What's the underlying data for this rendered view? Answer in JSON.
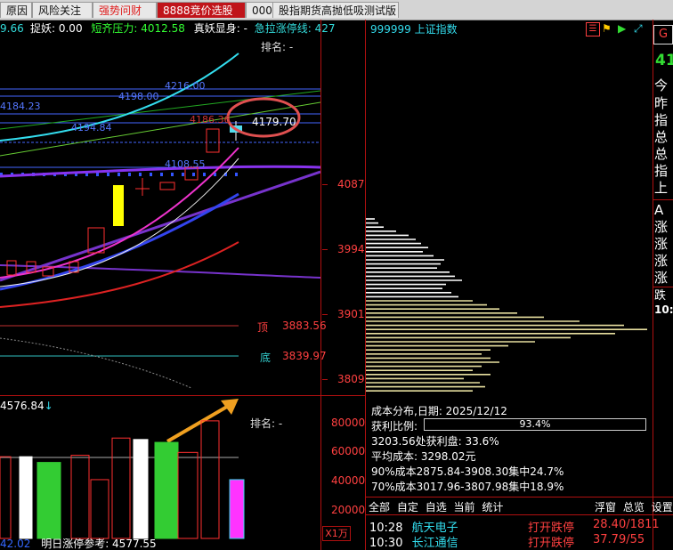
{
  "tabs": [
    {
      "label": "原因",
      "style": "normal"
    },
    {
      "label": "风险关注",
      "style": "normal"
    },
    {
      "label": "强势问财",
      "style": "red"
    },
    {
      "label": "8888竞价选股",
      "style": "active"
    },
    {
      "label": "000",
      "style": "normal"
    },
    {
      "label": "股指期货高抛低吸测试版",
      "style": "normal"
    }
  ],
  "header": {
    "left_value": "9.66",
    "item1": "捉妖: 0.00",
    "item2": "短齐压力: 4012.58",
    "item3": "真妖显身: -",
    "item4": "急拉涨停线: 427"
  },
  "main_chart": {
    "rank_label": "排名: -",
    "price_labels": [
      "4216.00",
      "4198.00",
      "4184.23",
      "4194.84",
      "4186.36",
      "4179.70",
      "4108.55"
    ],
    "top_label": "顶",
    "top_value": "3883.56",
    "bottom_label": "底",
    "bottom_value": "3839.97",
    "y_ticks": [
      "4087",
      "3994",
      "3901",
      "3809"
    ]
  },
  "volume_panel": {
    "top_value": "4576.84",
    "rank_label": "排名: -",
    "y_ticks": [
      "80000",
      "60000",
      "40000",
      "20000"
    ],
    "unit": "X1万",
    "footer_left": "42.02",
    "footer_label": "明日涨停参考: 4577.55",
    "bars": [
      {
        "value": 57000,
        "color": "white-hollow"
      },
      {
        "value": 57000,
        "color": "white"
      },
      {
        "value": 53000,
        "color": "green"
      },
      {
        "value": 58000,
        "color": "red-hollow"
      },
      {
        "value": 41000,
        "color": "red-hollow"
      },
      {
        "value": 70000,
        "color": "red-hollow"
      },
      {
        "value": 69000,
        "color": "white"
      },
      {
        "value": 67000,
        "color": "green"
      },
      {
        "value": 60000,
        "color": "red-hollow"
      },
      {
        "value": 82000,
        "color": "red-hollow"
      },
      {
        "value": 41000,
        "color": "magenta"
      }
    ]
  },
  "index_panel": {
    "title": "999999 上证指数",
    "info_title": "成本分布,日期: 2025/12/12",
    "profit_label": "获利比例:",
    "profit_value": "93.4%",
    "profit_fraction": 0.934,
    "line1": "3203.56处获利盘: 33.6%",
    "line2": "平均成本: 3298.02元",
    "line3": "90%成本2875.84-3908.30集中24.7%",
    "line4": "70%成本3017.96-3807.98集中18.9%"
  },
  "right_column": {
    "value": "41",
    "chars": [
      "今",
      "昨",
      "指",
      "总",
      "总",
      "指",
      "上",
      "A",
      "涨",
      "涨",
      "涨",
      "涨",
      "跌",
      "10:"
    ]
  },
  "bottom_tabs": [
    "全部",
    "自定",
    "自选",
    "当前",
    "统计"
  ],
  "bottom_actions": [
    "浮窗",
    "总览",
    "设置"
  ],
  "alerts": [
    {
      "time": "10:28",
      "name": "航天电子",
      "action": "打开跌停",
      "value": "28.40/1811"
    },
    {
      "time": "10:30",
      "name": "长江通信",
      "action": "打开跌停",
      "value": "37.79/55"
    }
  ],
  "colors": {
    "accent_red": "#c0141a",
    "up_red": "#ff3030",
    "down_green": "#33cc33",
    "highlight_circle": "#e05050",
    "arrow": "#f0a020"
  }
}
